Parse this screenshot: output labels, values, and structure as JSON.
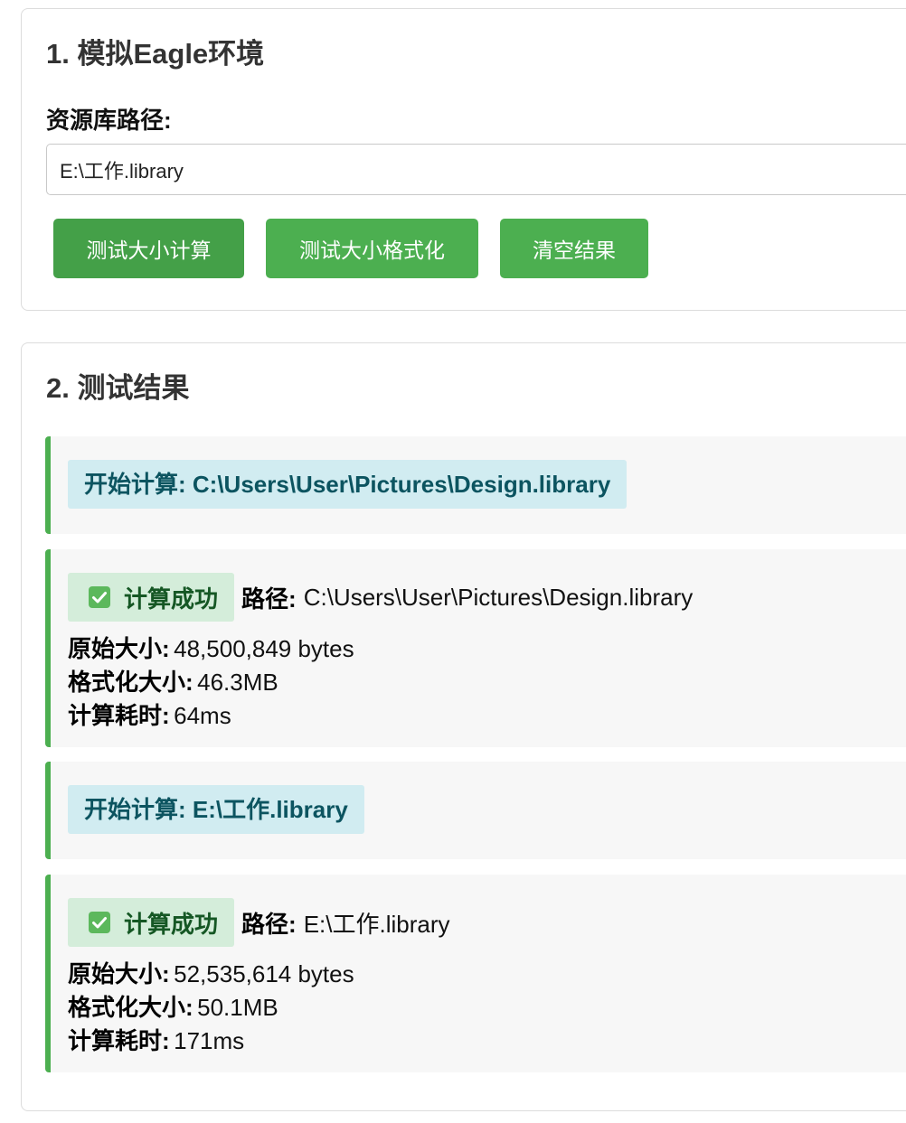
{
  "env": {
    "title": "1. 模拟Eagle环境",
    "library_label": "资源库路径:",
    "library_path": "E:\\工作.library",
    "buttons": {
      "calc": "测试大小计算",
      "format": "测试大小格式化",
      "clear": "清空结果"
    }
  },
  "results": {
    "title": "2. 测试结果",
    "labels": {
      "path": "路径:",
      "raw_size": "原始大小:",
      "formatted_size": "格式化大小:",
      "elapsed": "计算耗时:"
    },
    "entries": [
      {
        "type": "start",
        "text": "开始计算: C:\\Users\\User\\Pictures\\Design.library"
      },
      {
        "type": "success",
        "status": "计算成功",
        "path": "C:\\Users\\User\\Pictures\\Design.library",
        "raw_size": "48,500,849 bytes",
        "formatted_size": "46.3MB",
        "elapsed": "64ms"
      },
      {
        "type": "start",
        "text": "开始计算: E:\\工作.library"
      },
      {
        "type": "success",
        "status": "计算成功",
        "path": "E:\\工作.library",
        "raw_size": "52,535,614 bytes",
        "formatted_size": "50.1MB",
        "elapsed": "171ms"
      }
    ]
  },
  "colors": {
    "primary": "#4caf50",
    "info_bg": "#d1ecf1",
    "info_text": "#0c5460",
    "success_bg": "#d4edda",
    "success_text": "#155724"
  },
  "icons": {
    "success": "check-mark-icon"
  }
}
